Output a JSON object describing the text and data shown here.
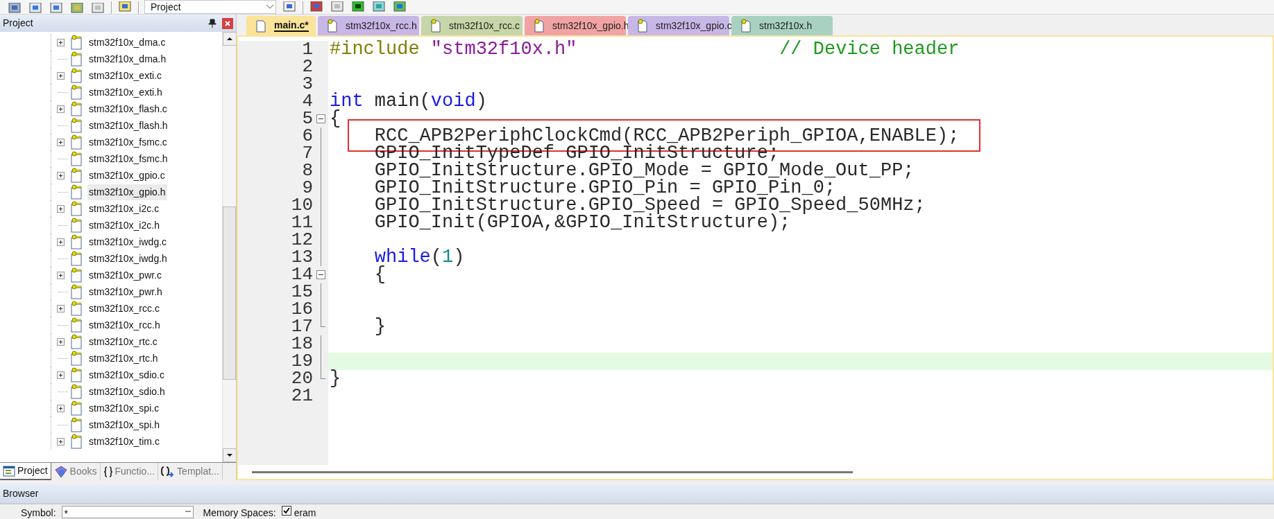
{
  "toolbar": {
    "dropdown": "Project"
  },
  "project_panel": {
    "title": "Project",
    "items": [
      {
        "label": "stm32f10x_dma.c",
        "expandable": true,
        "selected": false
      },
      {
        "label": "stm32f10x_dma.h",
        "expandable": false,
        "selected": false
      },
      {
        "label": "stm32f10x_exti.c",
        "expandable": true,
        "selected": false
      },
      {
        "label": "stm32f10x_exti.h",
        "expandable": false,
        "selected": false
      },
      {
        "label": "stm32f10x_flash.c",
        "expandable": true,
        "selected": false
      },
      {
        "label": "stm32f10x_flash.h",
        "expandable": false,
        "selected": false
      },
      {
        "label": "stm32f10x_fsmc.c",
        "expandable": true,
        "selected": false
      },
      {
        "label": "stm32f10x_fsmc.h",
        "expandable": false,
        "selected": false
      },
      {
        "label": "stm32f10x_gpio.c",
        "expandable": true,
        "selected": false
      },
      {
        "label": "stm32f10x_gpio.h",
        "expandable": false,
        "selected": true
      },
      {
        "label": "stm32f10x_i2c.c",
        "expandable": true,
        "selected": false
      },
      {
        "label": "stm32f10x_i2c.h",
        "expandable": false,
        "selected": false
      },
      {
        "label": "stm32f10x_iwdg.c",
        "expandable": true,
        "selected": false
      },
      {
        "label": "stm32f10x_iwdg.h",
        "expandable": false,
        "selected": false
      },
      {
        "label": "stm32f10x_pwr.c",
        "expandable": true,
        "selected": false
      },
      {
        "label": "stm32f10x_pwr.h",
        "expandable": false,
        "selected": false
      },
      {
        "label": "stm32f10x_rcc.c",
        "expandable": true,
        "selected": false
      },
      {
        "label": "stm32f10x_rcc.h",
        "expandable": false,
        "selected": false
      },
      {
        "label": "stm32f10x_rtc.c",
        "expandable": true,
        "selected": false
      },
      {
        "label": "stm32f10x_rtc.h",
        "expandable": false,
        "selected": false
      },
      {
        "label": "stm32f10x_sdio.c",
        "expandable": true,
        "selected": false
      },
      {
        "label": "stm32f10x_sdio.h",
        "expandable": false,
        "selected": false
      },
      {
        "label": "stm32f10x_spi.c",
        "expandable": true,
        "selected": false
      },
      {
        "label": "stm32f10x_spi.h",
        "expandable": false,
        "selected": false
      },
      {
        "label": "stm32f10x_tim.c",
        "expandable": true,
        "selected": false
      }
    ],
    "bottom_tabs": [
      {
        "label": "Project",
        "kind": "project",
        "selected": true
      },
      {
        "label": "Books",
        "kind": "books",
        "selected": false
      },
      {
        "label": "Functio...",
        "kind": "functions",
        "selected": false
      },
      {
        "label": "Templat...",
        "kind": "templates",
        "selected": false
      }
    ]
  },
  "editor": {
    "tabs": [
      {
        "label": "main.c*",
        "color": "#fbe39a",
        "selected": true
      },
      {
        "label": "stm32f10x_rcc.h",
        "color": "#c7b7e6",
        "selected": false
      },
      {
        "label": "stm32f10x_rcc.c",
        "color": "#c6d6a8",
        "selected": false
      },
      {
        "label": "stm32f10x_gpio.h",
        "color": "#f1a3a3",
        "selected": false
      },
      {
        "label": "stm32f10x_gpio.c",
        "color": "#c7b7e6",
        "selected": false
      },
      {
        "label": "stm32f10x.h",
        "color": "#a9d1c2",
        "selected": false
      }
    ],
    "lines": [
      {
        "number": "1",
        "tokens": [
          {
            "text": "#include ",
            "kind": "preproc"
          },
          {
            "text": "\"stm32f10x.h\"                  ",
            "kind": "string"
          },
          {
            "text": "// Device header",
            "kind": "comment"
          }
        ]
      },
      {
        "number": "2"
      },
      {
        "number": "3"
      },
      {
        "number": "4",
        "tokens": [
          {
            "text": "int",
            "kind": "keyword"
          },
          {
            "text": " main(",
            "kind": "plain"
          },
          {
            "text": "void",
            "kind": "keyword"
          },
          {
            "text": ")",
            "kind": "plain"
          }
        ]
      },
      {
        "number": "5",
        "collapse_box": true,
        "tokens": [
          {
            "text": "{",
            "kind": "plain"
          }
        ]
      },
      {
        "number": "6",
        "in_fold": true,
        "boxed": true,
        "tokens": [
          {
            "text": "    RCC_APB2PeriphClockCmd(RCC_APB2Periph_GPIOA,ENABLE);",
            "kind": "plain"
          }
        ]
      },
      {
        "number": "7",
        "in_fold": true,
        "tokens": [
          {
            "text": "    GPIO_InitTypeDef GPIO_InitStructure;",
            "kind": "plain"
          }
        ]
      },
      {
        "number": "8",
        "in_fold": true,
        "tokens": [
          {
            "text": "    GPIO_InitStructure.GPIO_Mode = GPIO_Mode_Out_PP;",
            "kind": "plain"
          }
        ]
      },
      {
        "number": "9",
        "in_fold": true,
        "tokens": [
          {
            "text": "    GPIO_InitStructure.GPIO_Pin = GPIO_Pin_0;",
            "kind": "plain"
          }
        ]
      },
      {
        "number": "10",
        "in_fold": true,
        "tokens": [
          {
            "text": "    GPIO_InitStructure.GPIO_Speed = GPIO_Speed_50MHz;",
            "kind": "plain"
          }
        ]
      },
      {
        "number": "11",
        "in_fold": true,
        "tokens": [
          {
            "text": "    GPIO_Init(GPIOA,&GPIO_InitStructure);",
            "kind": "plain"
          }
        ]
      },
      {
        "number": "12",
        "in_fold": true
      },
      {
        "number": "13",
        "in_fold": true,
        "tokens": [
          {
            "text": "    while",
            "kind": "keyword"
          },
          {
            "text": "(",
            "kind": "plain"
          },
          {
            "text": "1",
            "kind": "number"
          },
          {
            "text": ")",
            "kind": "plain"
          }
        ]
      },
      {
        "number": "14",
        "collapse_box": true,
        "tokens": [
          {
            "text": "    {",
            "kind": "plain"
          }
        ]
      },
      {
        "number": "15",
        "in_fold": true
      },
      {
        "number": "16",
        "in_fold": true
      },
      {
        "number": "17",
        "fold_end": true,
        "tokens": [
          {
            "text": "    }",
            "kind": "plain"
          }
        ]
      },
      {
        "number": "18",
        "in_fold": true
      },
      {
        "number": "19",
        "in_fold": true,
        "current": true
      },
      {
        "number": "20",
        "fold_end": true,
        "tokens": [
          {
            "text": "}",
            "kind": "plain"
          }
        ]
      },
      {
        "number": "21"
      }
    ]
  },
  "browser": {
    "title": "Browser",
    "symbol_label": "Symbol:",
    "symbol_value": "*",
    "memory_label": "Memory Spaces:",
    "memory_option": {
      "label": "eram",
      "checked": true
    }
  }
}
